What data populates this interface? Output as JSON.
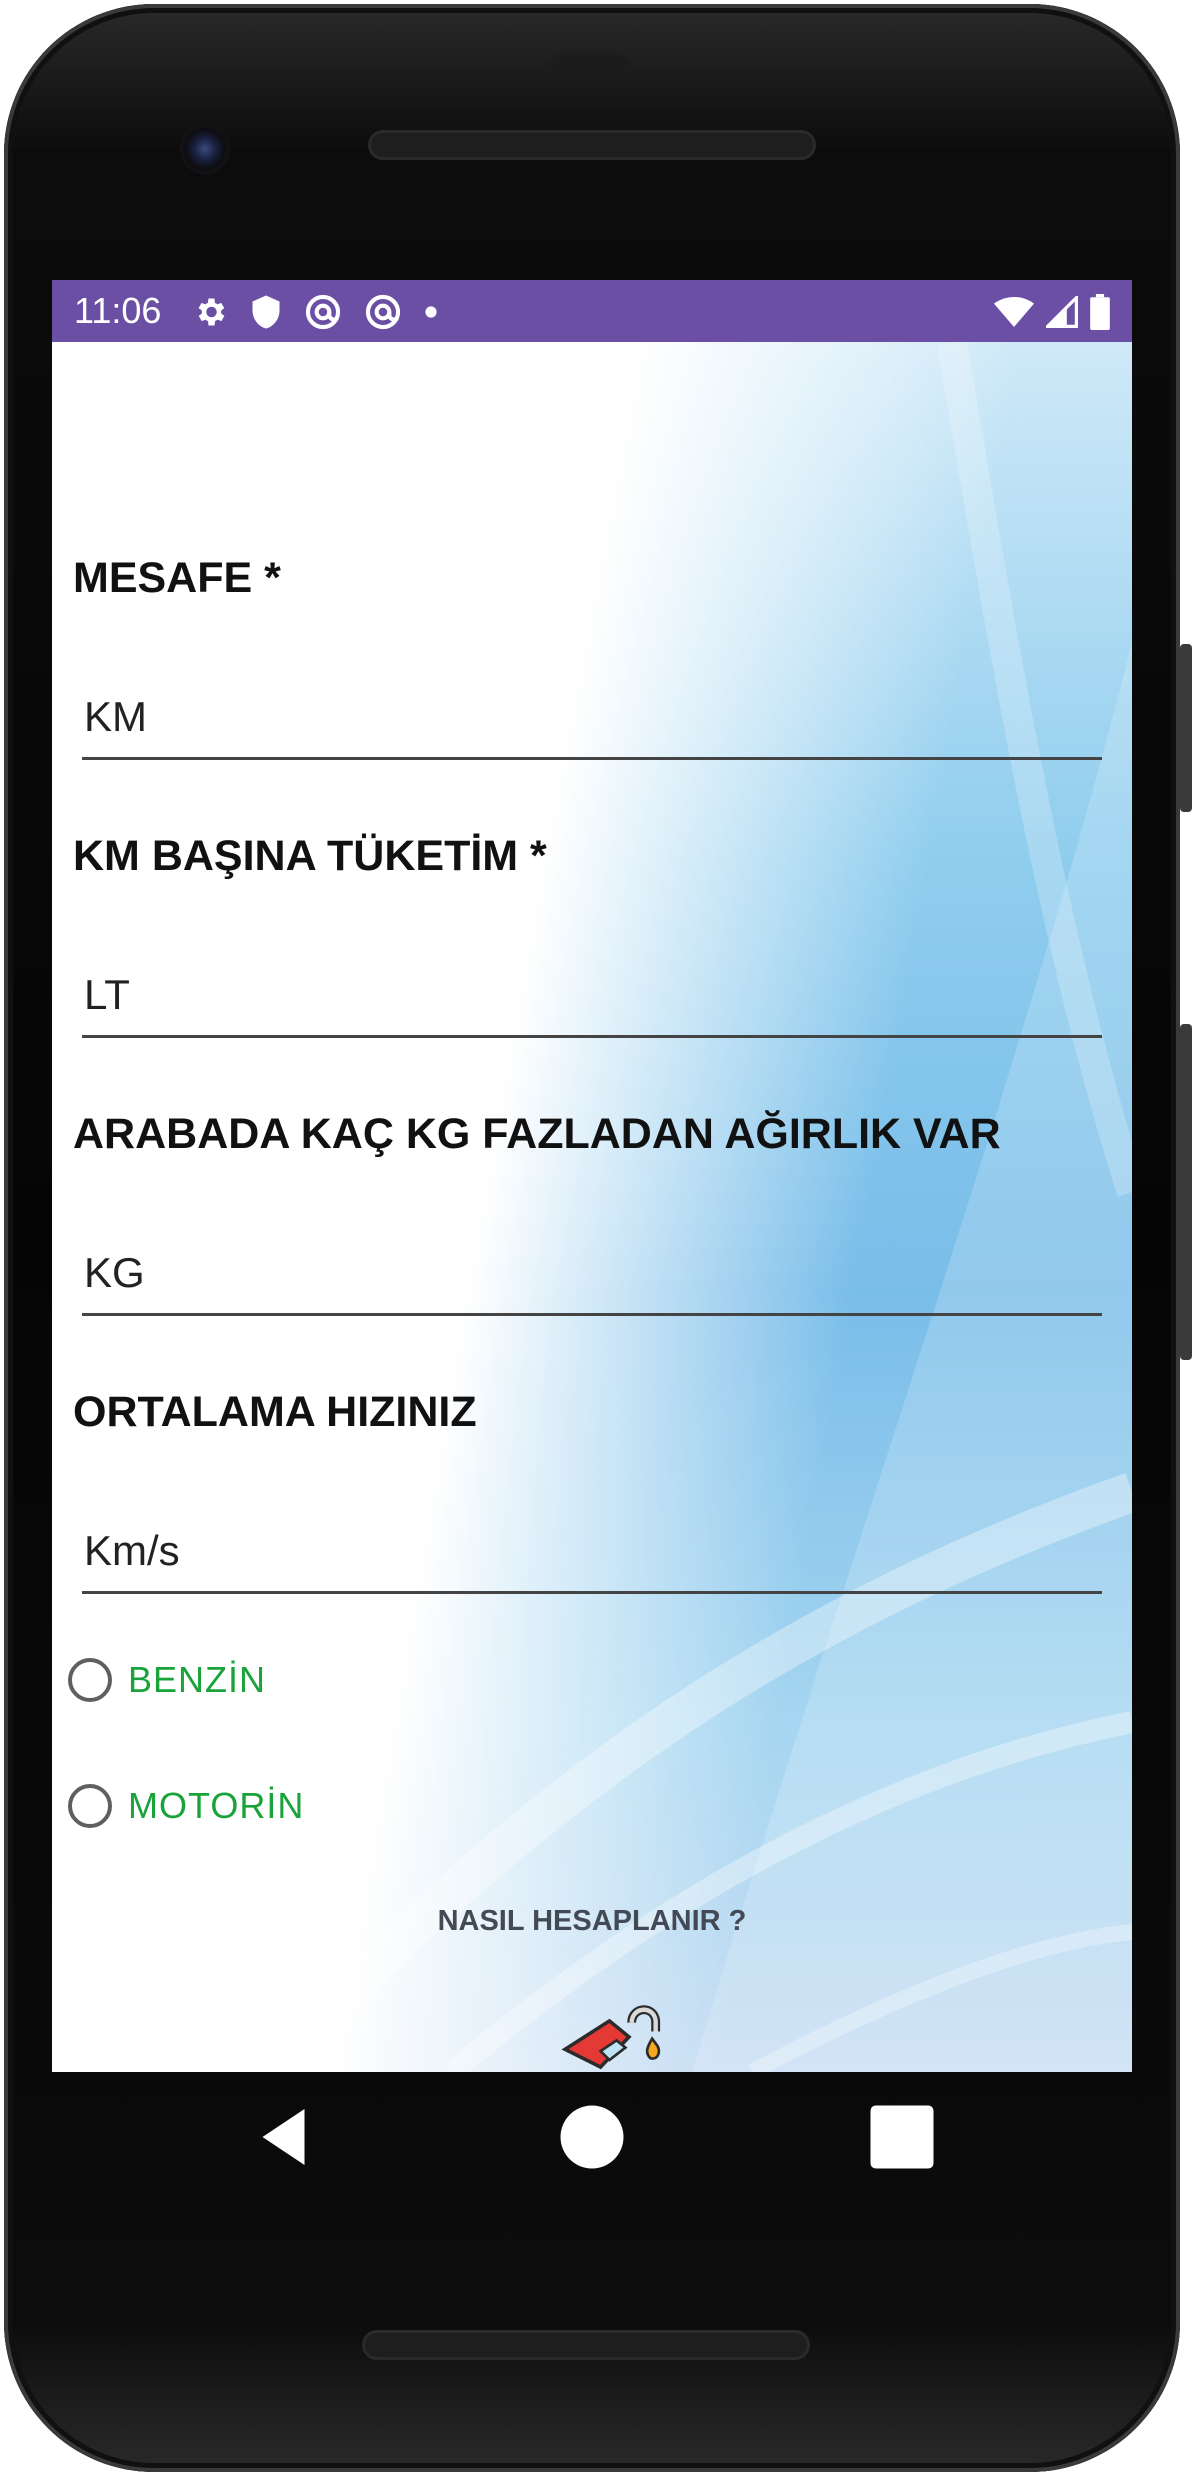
{
  "status_bar": {
    "time": "11:06",
    "left_icons": [
      "gear-icon",
      "shield-icon",
      "at-sign-icon",
      "at-sign-icon",
      "dot-icon"
    ],
    "right_icons": [
      "wifi-icon",
      "signal-icon",
      "battery-icon"
    ],
    "background_color": "#6a4fa4"
  },
  "form": {
    "distance": {
      "label": "MESAFE *",
      "placeholder": "KM"
    },
    "consumption": {
      "label": "KM BAŞINA TÜKETİM *",
      "placeholder": "LT"
    },
    "extra_weight": {
      "label": "ARABADA KAÇ KG FAZLADAN AĞIRLIK VAR",
      "placeholder": "KG"
    },
    "avg_speed": {
      "label": "ORTALAMA HIZINIZ",
      "placeholder": "Km/s"
    }
  },
  "fuel_type": {
    "options": [
      {
        "label": "BENZİN",
        "selected": false
      },
      {
        "label": "MOTORİN",
        "selected": false
      }
    ],
    "label_color": "#1aa33a"
  },
  "how_link": {
    "label": "NASIL HESAPLANIR ?"
  },
  "nav_bar": {
    "buttons": [
      "back-triangle-icon",
      "home-circle-icon",
      "recents-square-icon"
    ]
  }
}
